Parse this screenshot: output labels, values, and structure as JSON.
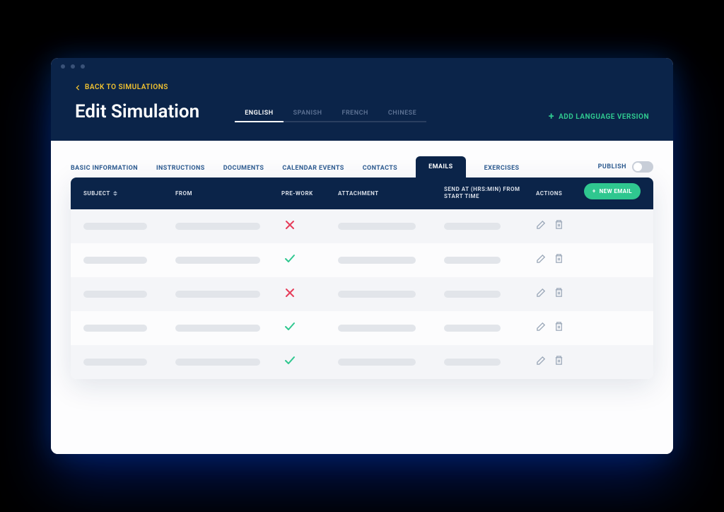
{
  "nav": {
    "back": "Back to Simulations"
  },
  "page": {
    "title": "Edit Simulation"
  },
  "languages": {
    "items": [
      "English",
      "Spanish",
      "French",
      "Chinese"
    ],
    "activeIndex": 0,
    "add": "Add Language Version"
  },
  "tabs": {
    "items": [
      "Basic Information",
      "Instructions",
      "Documents",
      "Calendar Events",
      "Contacts",
      "Emails",
      "Exercises"
    ],
    "activeIndex": 5
  },
  "publish": {
    "label": "Publish",
    "on": false
  },
  "table": {
    "columns": {
      "subject": "Subject",
      "from": "From",
      "prework": "Pre-Work",
      "attachment": "Attachment",
      "send": "Send at (Hrs:Min) From Start Time",
      "actions": "Actions"
    },
    "newButton": "New Email",
    "rows": [
      {
        "prework": false
      },
      {
        "prework": true
      },
      {
        "prework": false
      },
      {
        "prework": true
      },
      {
        "prework": true
      }
    ]
  },
  "icons": {
    "plus": "+",
    "sort": "sort"
  }
}
